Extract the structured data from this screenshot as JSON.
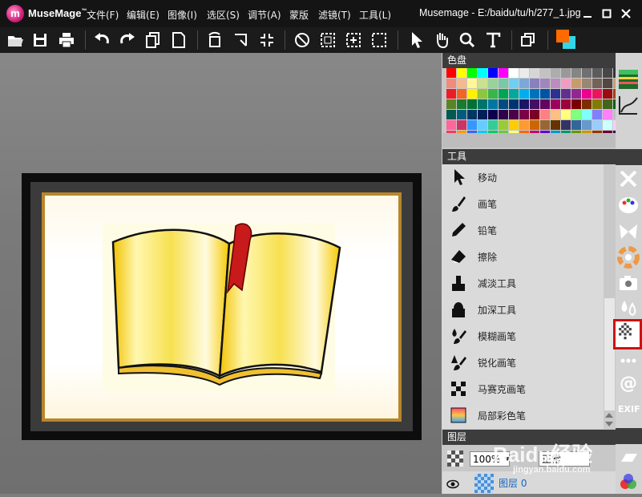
{
  "app": {
    "brand": "MuseMage",
    "brand_tm": "™",
    "window_title": "Musemage - E:/baidu/tu/h/277_1.jpg",
    "logo_letter": "m"
  },
  "menu": [
    "文件(F)",
    "编辑(E)",
    "图像(I)",
    "选区(S)",
    "调节(A)",
    "蒙版",
    "滤镜(T)",
    "工具(L)"
  ],
  "toolbar": {
    "buttons": [
      "open-icon",
      "save-icon",
      "print-icon",
      "undo-icon",
      "redo-icon",
      "copy-icon",
      "paste-icon",
      "rotate-icon",
      "flip-icon",
      "resize-icon",
      "deselect-icon",
      "select-all-icon",
      "select-center-icon",
      "crop-select-icon",
      "pointer-icon",
      "hand-icon",
      "zoom-icon",
      "text-icon",
      "layers-copy-icon"
    ],
    "fg_color": "#ff6a00",
    "bg_color": "#33d6e6"
  },
  "palette": {
    "title": "色盘",
    "colors": [
      "#ff0000",
      "#ffff00",
      "#00ff00",
      "#00ffff",
      "#0000ff",
      "#ff00ff",
      "#ffffff",
      "#ebebeb",
      "#d6d6d6",
      "#c2c2c2",
      "#adadad",
      "#999999",
      "#858585",
      "#707070",
      "#5c5c5c",
      "#474747",
      "#333333",
      "#000000",
      "#f28b7c",
      "#f7b98c",
      "#fff799",
      "#c8e28e",
      "#9ad29b",
      "#79c8a7",
      "#6dcff6",
      "#7da7d9",
      "#8781bd",
      "#a186be",
      "#bd8cbf",
      "#f49ac2",
      "#c69c6d",
      "#998675",
      "#736357",
      "#534741",
      "#c69c6c",
      "#8c6239",
      "#ed1c24",
      "#f26522",
      "#fff200",
      "#8dc63f",
      "#39b54a",
      "#00a651",
      "#00a99d",
      "#00aeef",
      "#0072bc",
      "#0054a6",
      "#2e3192",
      "#662d91",
      "#92278f",
      "#ec008c",
      "#ed145b",
      "#9e0b0f",
      "#a0410d",
      "#aba000",
      "#598527",
      "#197b30",
      "#007236",
      "#00746b",
      "#0076a3",
      "#004b80",
      "#003471",
      "#1b1464",
      "#440e62",
      "#630460",
      "#9e005d",
      "#9e0039",
      "#790000",
      "#7b2e00",
      "#827b00",
      "#406618",
      "#005e20",
      "#005826",
      "#005952",
      "#005b7f",
      "#003663",
      "#002157",
      "#0d004c",
      "#32004b",
      "#4b0049",
      "#7b0046",
      "#7a0026",
      "#ff8080",
      "#ffbf80",
      "#ffff80",
      "#80ff80",
      "#80ffff",
      "#8080ff",
      "#ff80ff",
      "#c0c0c0",
      "#404040",
      "#ff6699",
      "#cc3366",
      "#3399ff",
      "#66ccff",
      "#33cc99",
      "#99cc33",
      "#ffcc00",
      "#ff9933",
      "#cc6600",
      "#996633",
      "#663300",
      "#333366",
      "#336699",
      "#6699cc",
      "#99ccff",
      "#ccffff",
      "#ffccff",
      "#ffcccc",
      "#ff3366",
      "#ff9900",
      "#3366ff",
      "#00ccff",
      "#00cc66",
      "#66cc33",
      "#ffff66",
      "#ff6600",
      "#cc0066",
      "#6600cc",
      "#0099cc",
      "#009966",
      "#669900",
      "#cc9900",
      "#993300",
      "#660033",
      "#330066",
      "#003366"
    ]
  },
  "tools": {
    "title": "工具",
    "items": [
      {
        "label": "移动",
        "icon": "move-arrow-icon"
      },
      {
        "label": "画笔",
        "icon": "brush-icon"
      },
      {
        "label": "铅笔",
        "icon": "pencil-icon"
      },
      {
        "label": "擦除",
        "icon": "eraser-icon"
      },
      {
        "label": "减淡工具",
        "icon": "dodge-icon"
      },
      {
        "label": "加深工具",
        "icon": "burn-icon"
      },
      {
        "label": "模糊画笔",
        "icon": "blur-brush-icon"
      },
      {
        "label": "锐化画笔",
        "icon": "sharpen-brush-icon"
      },
      {
        "label": "马赛克画笔",
        "icon": "mosaic-brush-icon"
      },
      {
        "label": "局部彩色笔",
        "icon": "local-color-brush-icon"
      }
    ]
  },
  "layers": {
    "title": "图层",
    "opacity": "100%",
    "blend_mode": "正常",
    "layer_name": "图层 0"
  },
  "right_strip": [
    "histogram-icon",
    "curve-icon",
    "tools-icon",
    "palette-icon",
    "butterfly-icon",
    "color-wheel-icon",
    "camera-icon",
    "drops-icon",
    "mosaic-icon",
    "more-icon",
    "at-icon",
    "exif-icon"
  ],
  "exif_label": "EXIF",
  "watermark": {
    "text": "Baidu经验",
    "url": "jingyan.baidu.com"
  },
  "colors": {
    "selected_outline": "#d01010"
  }
}
